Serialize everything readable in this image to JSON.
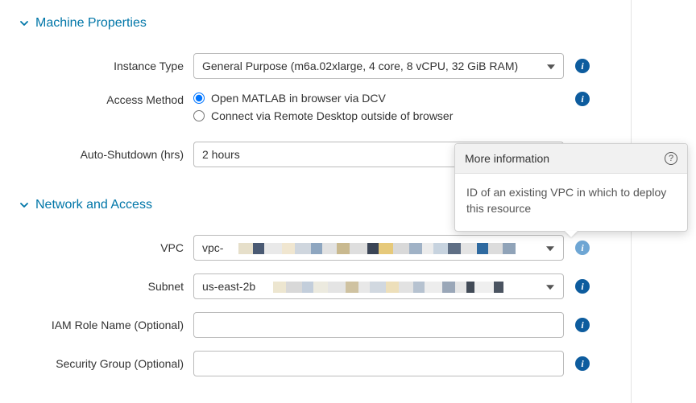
{
  "sections": {
    "machine": {
      "title": "Machine Properties",
      "instance_type": {
        "label": "Instance Type",
        "value": "General Purpose (m6a.02xlarge, 4 core, 8 vCPU, 32 GiB RAM)"
      },
      "access_method": {
        "label": "Access Method",
        "option1": "Open MATLAB in browser via DCV",
        "option2": "Connect via Remote Desktop outside of browser"
      },
      "auto_shutdown": {
        "label": "Auto-Shutdown (hrs)",
        "value": "2 hours"
      }
    },
    "network": {
      "title": "Network and Access",
      "vpc": {
        "label": "VPC",
        "value_prefix": "vpc-"
      },
      "subnet": {
        "label": "Subnet",
        "value_prefix": "us-east-2b"
      },
      "iam_role": {
        "label": "IAM Role Name (Optional)",
        "value": ""
      },
      "security_group": {
        "label": "Security Group (Optional)",
        "value": ""
      }
    }
  },
  "tooltip": {
    "title": "More information",
    "body": "ID of an existing VPC in which to deploy this resource"
  }
}
